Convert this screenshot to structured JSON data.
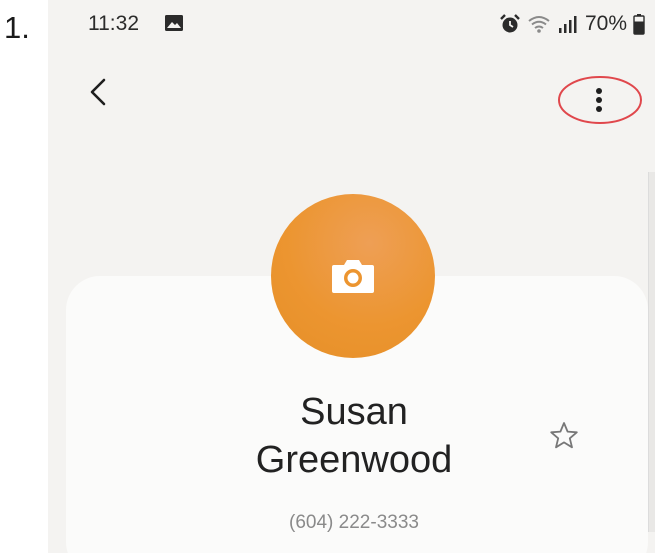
{
  "step": {
    "number": "1."
  },
  "status_bar": {
    "time": "11:32",
    "battery": "70%",
    "icons": [
      "image-icon",
      "alarm-icon",
      "wifi-icon",
      "signal-icon",
      "battery-icon"
    ]
  },
  "app_bar": {
    "back_icon": "chevron-left-icon",
    "more_icon": "more-vertical-icon",
    "highlight_color": "#e0474c"
  },
  "contact": {
    "avatar_icon": "camera-icon",
    "avatar_color": "#ec9530",
    "name": "Susan\nGreenwood",
    "name_line1": "Susan",
    "name_line2": "Greenwood",
    "phone": "(604) 222-3333",
    "favorite_icon": "star-outline-icon"
  }
}
